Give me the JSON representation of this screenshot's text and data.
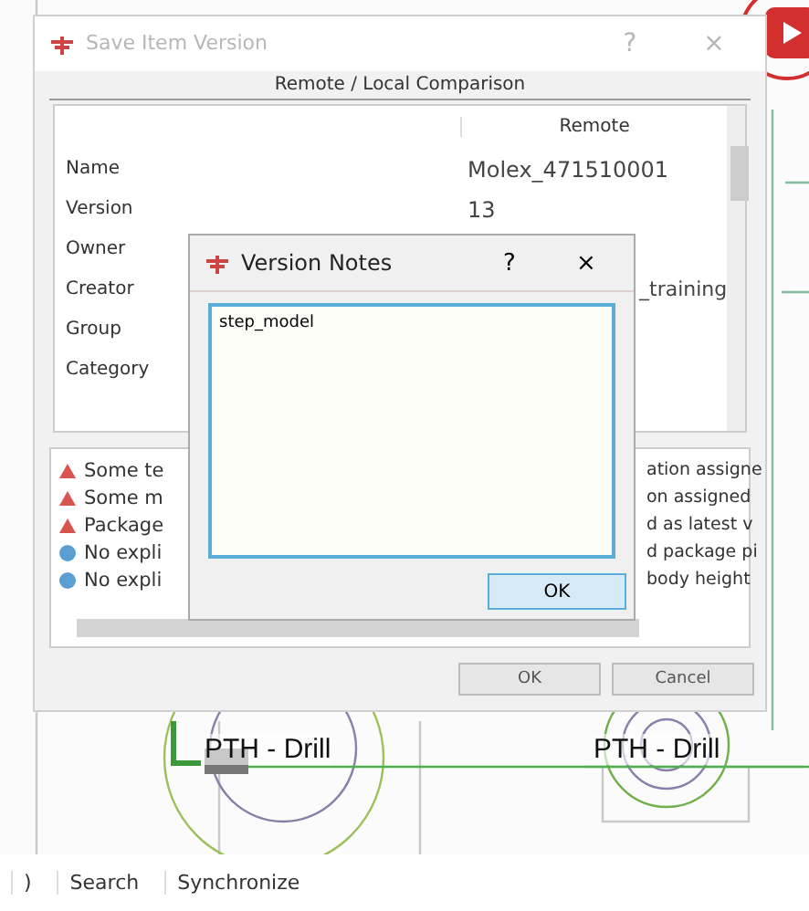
{
  "dialog": {
    "title": "Save Item Version",
    "help": "?",
    "close": "×",
    "section_title": "Remote / Local Comparison",
    "column": "Remote",
    "rows": [
      {
        "label": "Name",
        "remote": "Molex_471510001"
      },
      {
        "label": "Version",
        "remote": "13"
      },
      {
        "label": "Owner"
      },
      {
        "label": "Creator",
        "remote_end": "_training"
      },
      {
        "label": "Group"
      },
      {
        "label": "Category"
      }
    ],
    "messages": [
      {
        "kind": "warning",
        "start": "Some te",
        "end": "ation assigne"
      },
      {
        "kind": "warning",
        "start": "Some m",
        "end": "on assigned"
      },
      {
        "kind": "warning",
        "start": "Package",
        "end": "d as latest v"
      },
      {
        "kind": "info",
        "start": "No expli",
        "end": "d package pi"
      },
      {
        "kind": "info",
        "start": "No expli",
        "end": "body height"
      }
    ],
    "buttons": [
      "OK",
      "Cancel"
    ]
  },
  "notes_dialog": {
    "title": "Version Notes",
    "help": "?",
    "close": "×",
    "value": "step_model",
    "button": "OK"
  },
  "canvas": {
    "labels": [
      "PTH - Drill",
      "PTH - Drill"
    ]
  },
  "toolbar_items": [
    ")",
    "Search",
    "Synchronize"
  ]
}
